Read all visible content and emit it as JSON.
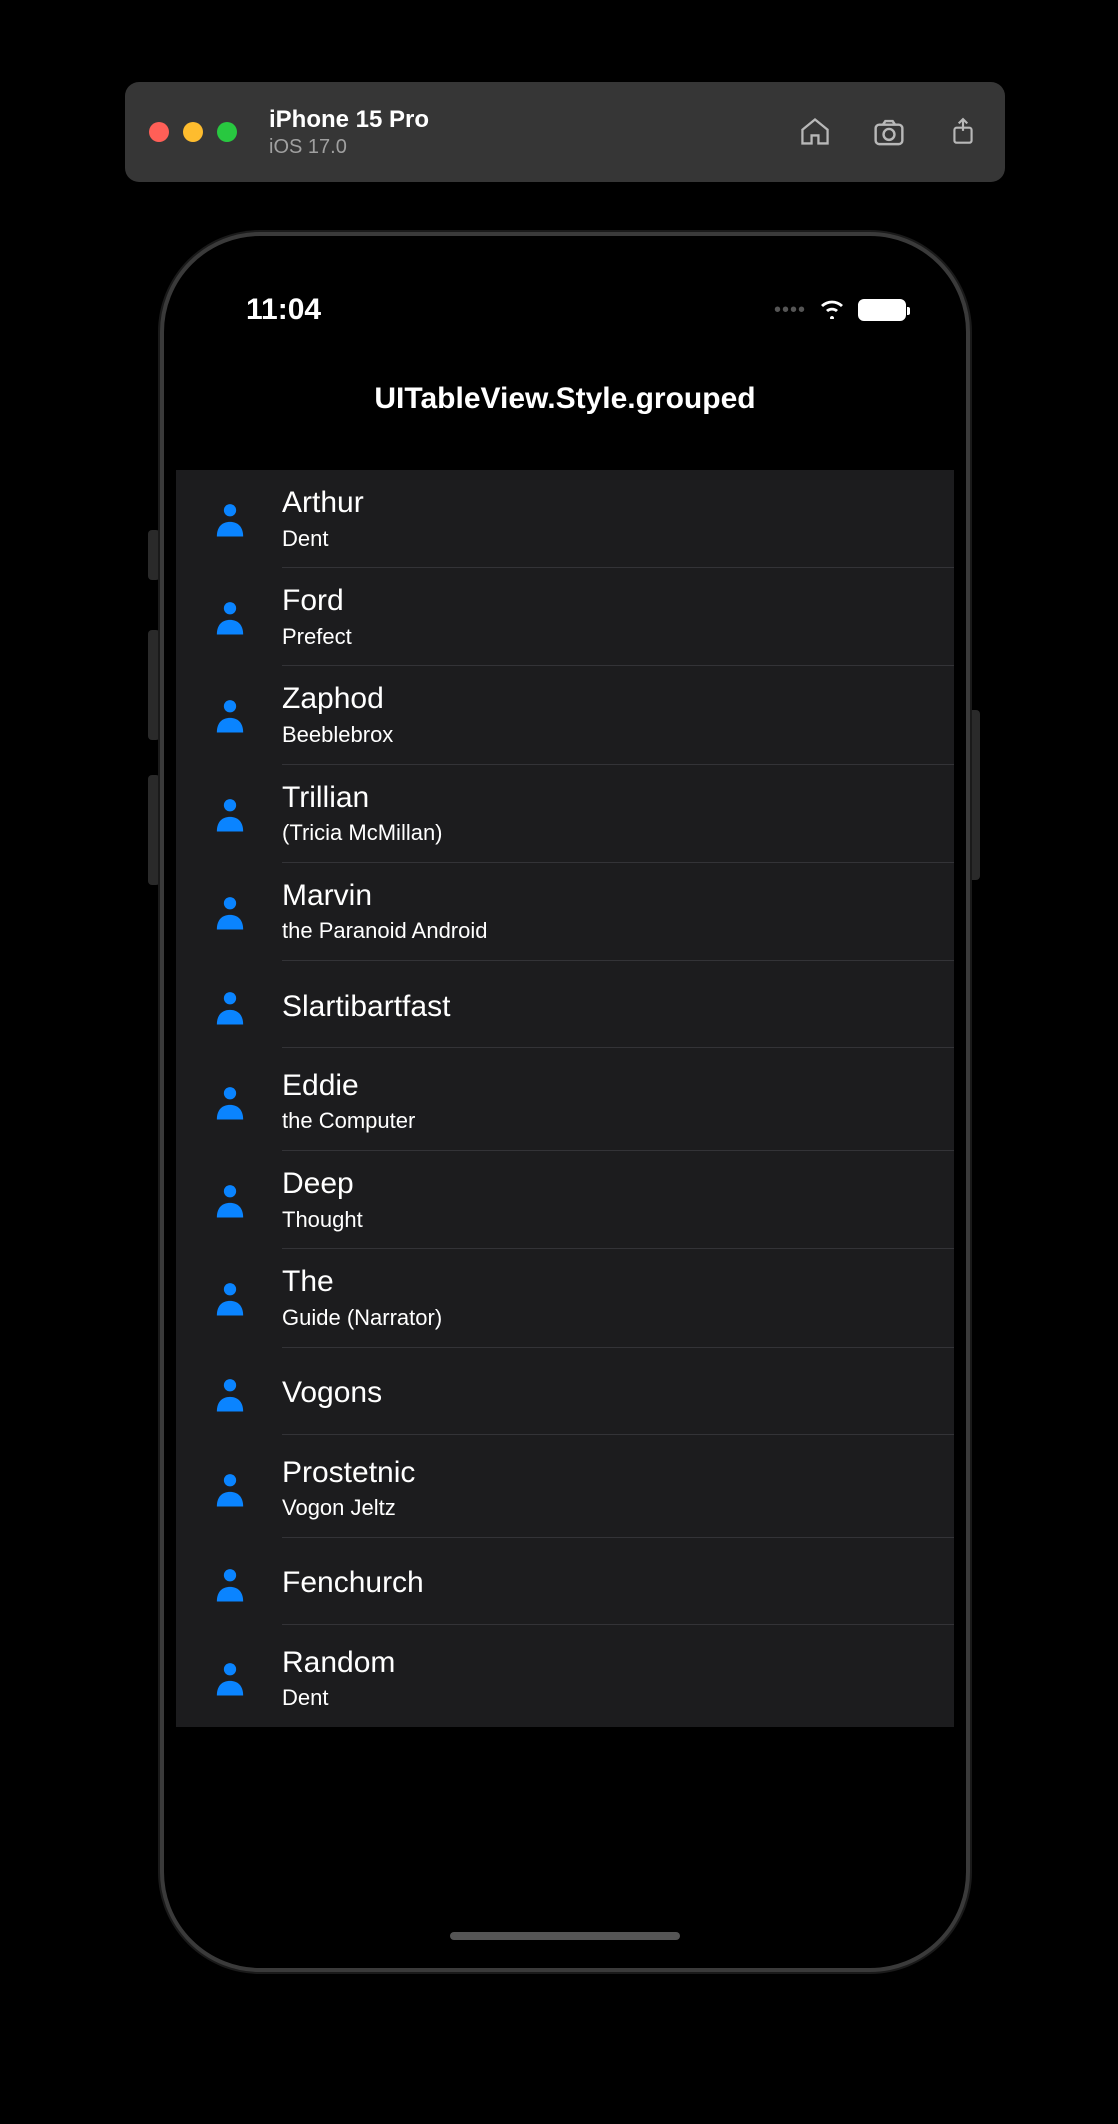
{
  "chrome": {
    "title": "iPhone 15 Pro",
    "subtitle": "iOS 17.0"
  },
  "status": {
    "time": "11:04"
  },
  "nav": {
    "title": "UITableView.Style.grouped"
  },
  "rows": [
    {
      "title": "Arthur",
      "subtitle": "Dent"
    },
    {
      "title": "Ford",
      "subtitle": "Prefect"
    },
    {
      "title": "Zaphod",
      "subtitle": "Beeblebrox"
    },
    {
      "title": "Trillian",
      "subtitle": "(Tricia McMillan)"
    },
    {
      "title": "Marvin",
      "subtitle": "the Paranoid Android"
    },
    {
      "title": "Slartibartfast",
      "subtitle": ""
    },
    {
      "title": "Eddie",
      "subtitle": "the Computer"
    },
    {
      "title": "Deep",
      "subtitle": "Thought"
    },
    {
      "title": "The",
      "subtitle": "Guide (Narrator)"
    },
    {
      "title": "Vogons",
      "subtitle": ""
    },
    {
      "title": "Prostetnic",
      "subtitle": "Vogon Jeltz"
    },
    {
      "title": "Fenchurch",
      "subtitle": ""
    },
    {
      "title": "Random",
      "subtitle": "Dent"
    }
  ]
}
